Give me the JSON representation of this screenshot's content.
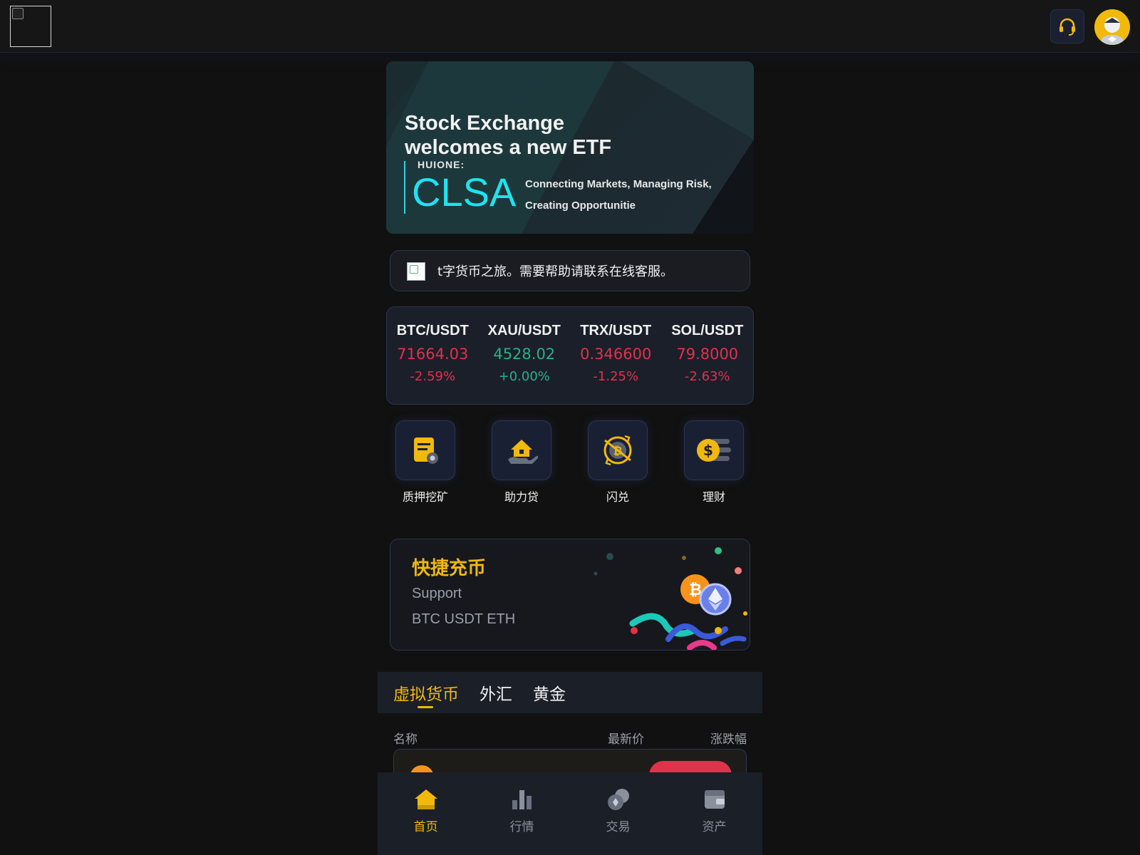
{
  "header": {
    "logo_icon": "broken-image-icon",
    "support_icon": "headset-icon",
    "avatar_icon": "user-avatar-icon"
  },
  "banner": {
    "title": "Stock Exchange welcomes a new ETF",
    "brand": "HUIONE:",
    "name": "CLSA",
    "tagline": "Connecting Markets, Managing Risk, Creating Opportunitie"
  },
  "notice": {
    "icon": "broken-image-icon",
    "text": "t字货币之旅。需要帮助请联系在线客服。"
  },
  "tickers": [
    {
      "pair": "BTC/USDT",
      "price": "71664.03",
      "change": "-2.59%",
      "trend": "down"
    },
    {
      "pair": "XAU/USDT",
      "price": "4528.02",
      "change": "+0.00%",
      "trend": "up"
    },
    {
      "pair": "TRX/USDT",
      "price": "0.346600",
      "change": "-1.25%",
      "trend": "down"
    },
    {
      "pair": "SOL/USDT",
      "price": "79.8000",
      "change": "-2.63%",
      "trend": "down"
    }
  ],
  "shortcuts": [
    {
      "label": "质押挖矿",
      "icon": "document-stake-icon"
    },
    {
      "label": "助力贷",
      "icon": "home-loan-icon"
    },
    {
      "label": "闪兑",
      "icon": "swap-coin-icon"
    },
    {
      "label": "理财",
      "icon": "dollar-finance-icon"
    }
  ],
  "deposit": {
    "title": "快捷充币",
    "line1": "Support",
    "line2": "BTC USDT ETH"
  },
  "market_tabs": [
    {
      "label": "虚拟货币",
      "active": true
    },
    {
      "label": "外汇",
      "active": false
    },
    {
      "label": "黄金",
      "active": false
    }
  ],
  "list_header": {
    "name": "名称",
    "price": "最新价",
    "change": "涨跌幅"
  },
  "bottom_nav": [
    {
      "label": "首页",
      "icon": "home-icon",
      "active": true
    },
    {
      "label": "行情",
      "icon": "bar-chart-icon",
      "active": false
    },
    {
      "label": "交易",
      "icon": "trade-coins-icon",
      "active": false
    },
    {
      "label": "资产",
      "icon": "wallet-icon",
      "active": false
    }
  ],
  "colors": {
    "accent": "#f0b90b",
    "down": "#e0324b",
    "up": "#28b087",
    "background": "#111111",
    "panel": "#1b1f27"
  }
}
